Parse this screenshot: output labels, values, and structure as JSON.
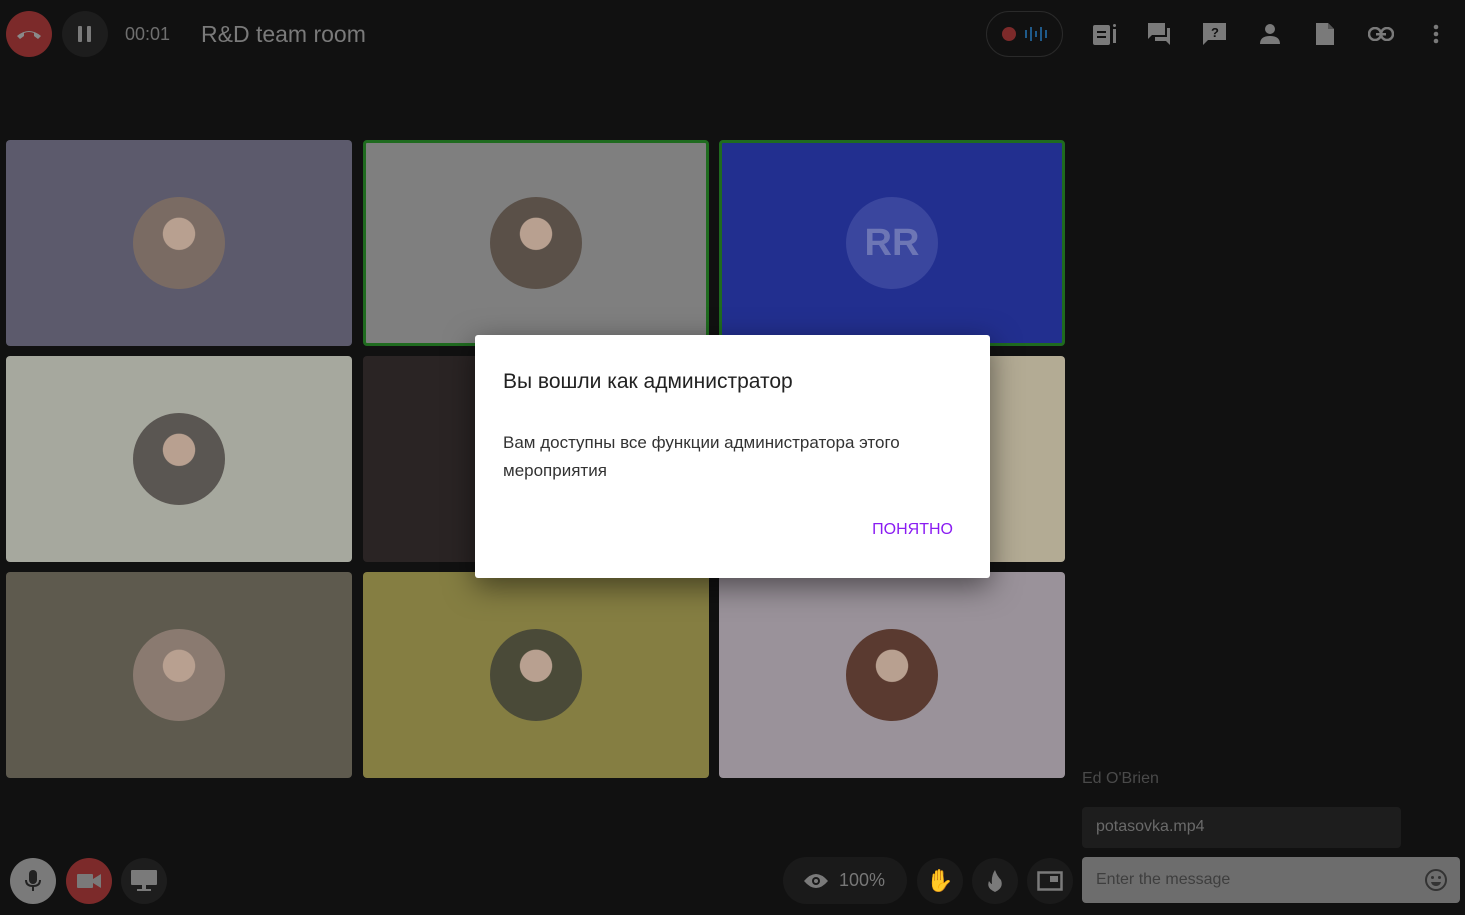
{
  "header": {
    "timer": "00:01",
    "room_title": "R&D team room"
  },
  "tiles": [
    {
      "color": "#5c5a6c",
      "active": false,
      "avatar": "#7a6b63"
    },
    {
      "color": "#7f7f7f",
      "active": true,
      "avatar": "#5a5048"
    },
    {
      "color": "#222f8f",
      "active": true,
      "initials": "RR"
    },
    {
      "color": "#a6a89e",
      "active": false,
      "avatar": "#5a5652"
    },
    {
      "color": "#2a2424",
      "active": false
    },
    {
      "color": "#b3ab94",
      "active": false
    },
    {
      "color": "#5e5a4e",
      "active": false,
      "avatar": "#8a7a70"
    },
    {
      "color": "#857e42",
      "active": false,
      "avatar": "#4a4a38"
    },
    {
      "color": "#9a929a",
      "active": false,
      "avatar": "#5a3a30"
    }
  ],
  "modal": {
    "title": "Вы вошли как администратор",
    "body": "Вам доступны все функции администратора этого мероприятия",
    "ok_label": "ПОНЯТНО"
  },
  "bottom": {
    "view_percent": "100%"
  },
  "chat": {
    "sender": "Ed O'Brien",
    "file_name": "potasovka.mp4",
    "input_placeholder": "Enter the message"
  },
  "colors": {
    "accent": "#8a1cf2",
    "danger": "#7c2a2a",
    "active_border": "#1f6b1f"
  }
}
